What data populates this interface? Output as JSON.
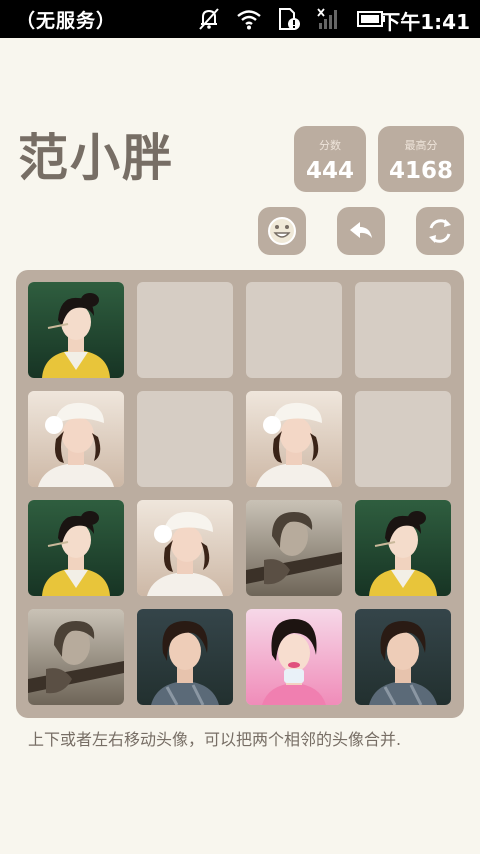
{
  "status_bar": {
    "carrier": "（无服务）",
    "time": "下午1:41",
    "icons": [
      "mute-bell-icon",
      "wifi-icon",
      "sim-alert-icon",
      "signal-off-icon",
      "battery-icon"
    ]
  },
  "header": {
    "title": "范小胖",
    "score_label": "分数",
    "score_value": "444",
    "best_label": "最高分",
    "best_value": "4168"
  },
  "controls": [
    "smiley-face-icon",
    "undo-arrow-icon",
    "refresh-icon"
  ],
  "board": {
    "rows": [
      [
        "portrait-green-yellow",
        "empty",
        "empty",
        "empty"
      ],
      [
        "portrait-white-hat",
        "empty",
        "portrait-white-hat",
        "empty"
      ],
      [
        "portrait-green-yellow",
        "portrait-white-hat",
        "portrait-sepia-rifle",
        "portrait-green-yellow"
      ],
      [
        "portrait-sepia-rifle",
        "portrait-bob-hair",
        "portrait-pink-bg",
        "portrait-bob-hair"
      ]
    ]
  },
  "hint": "上下或者左右移动头像，可以把两个相邻的头像合并."
}
